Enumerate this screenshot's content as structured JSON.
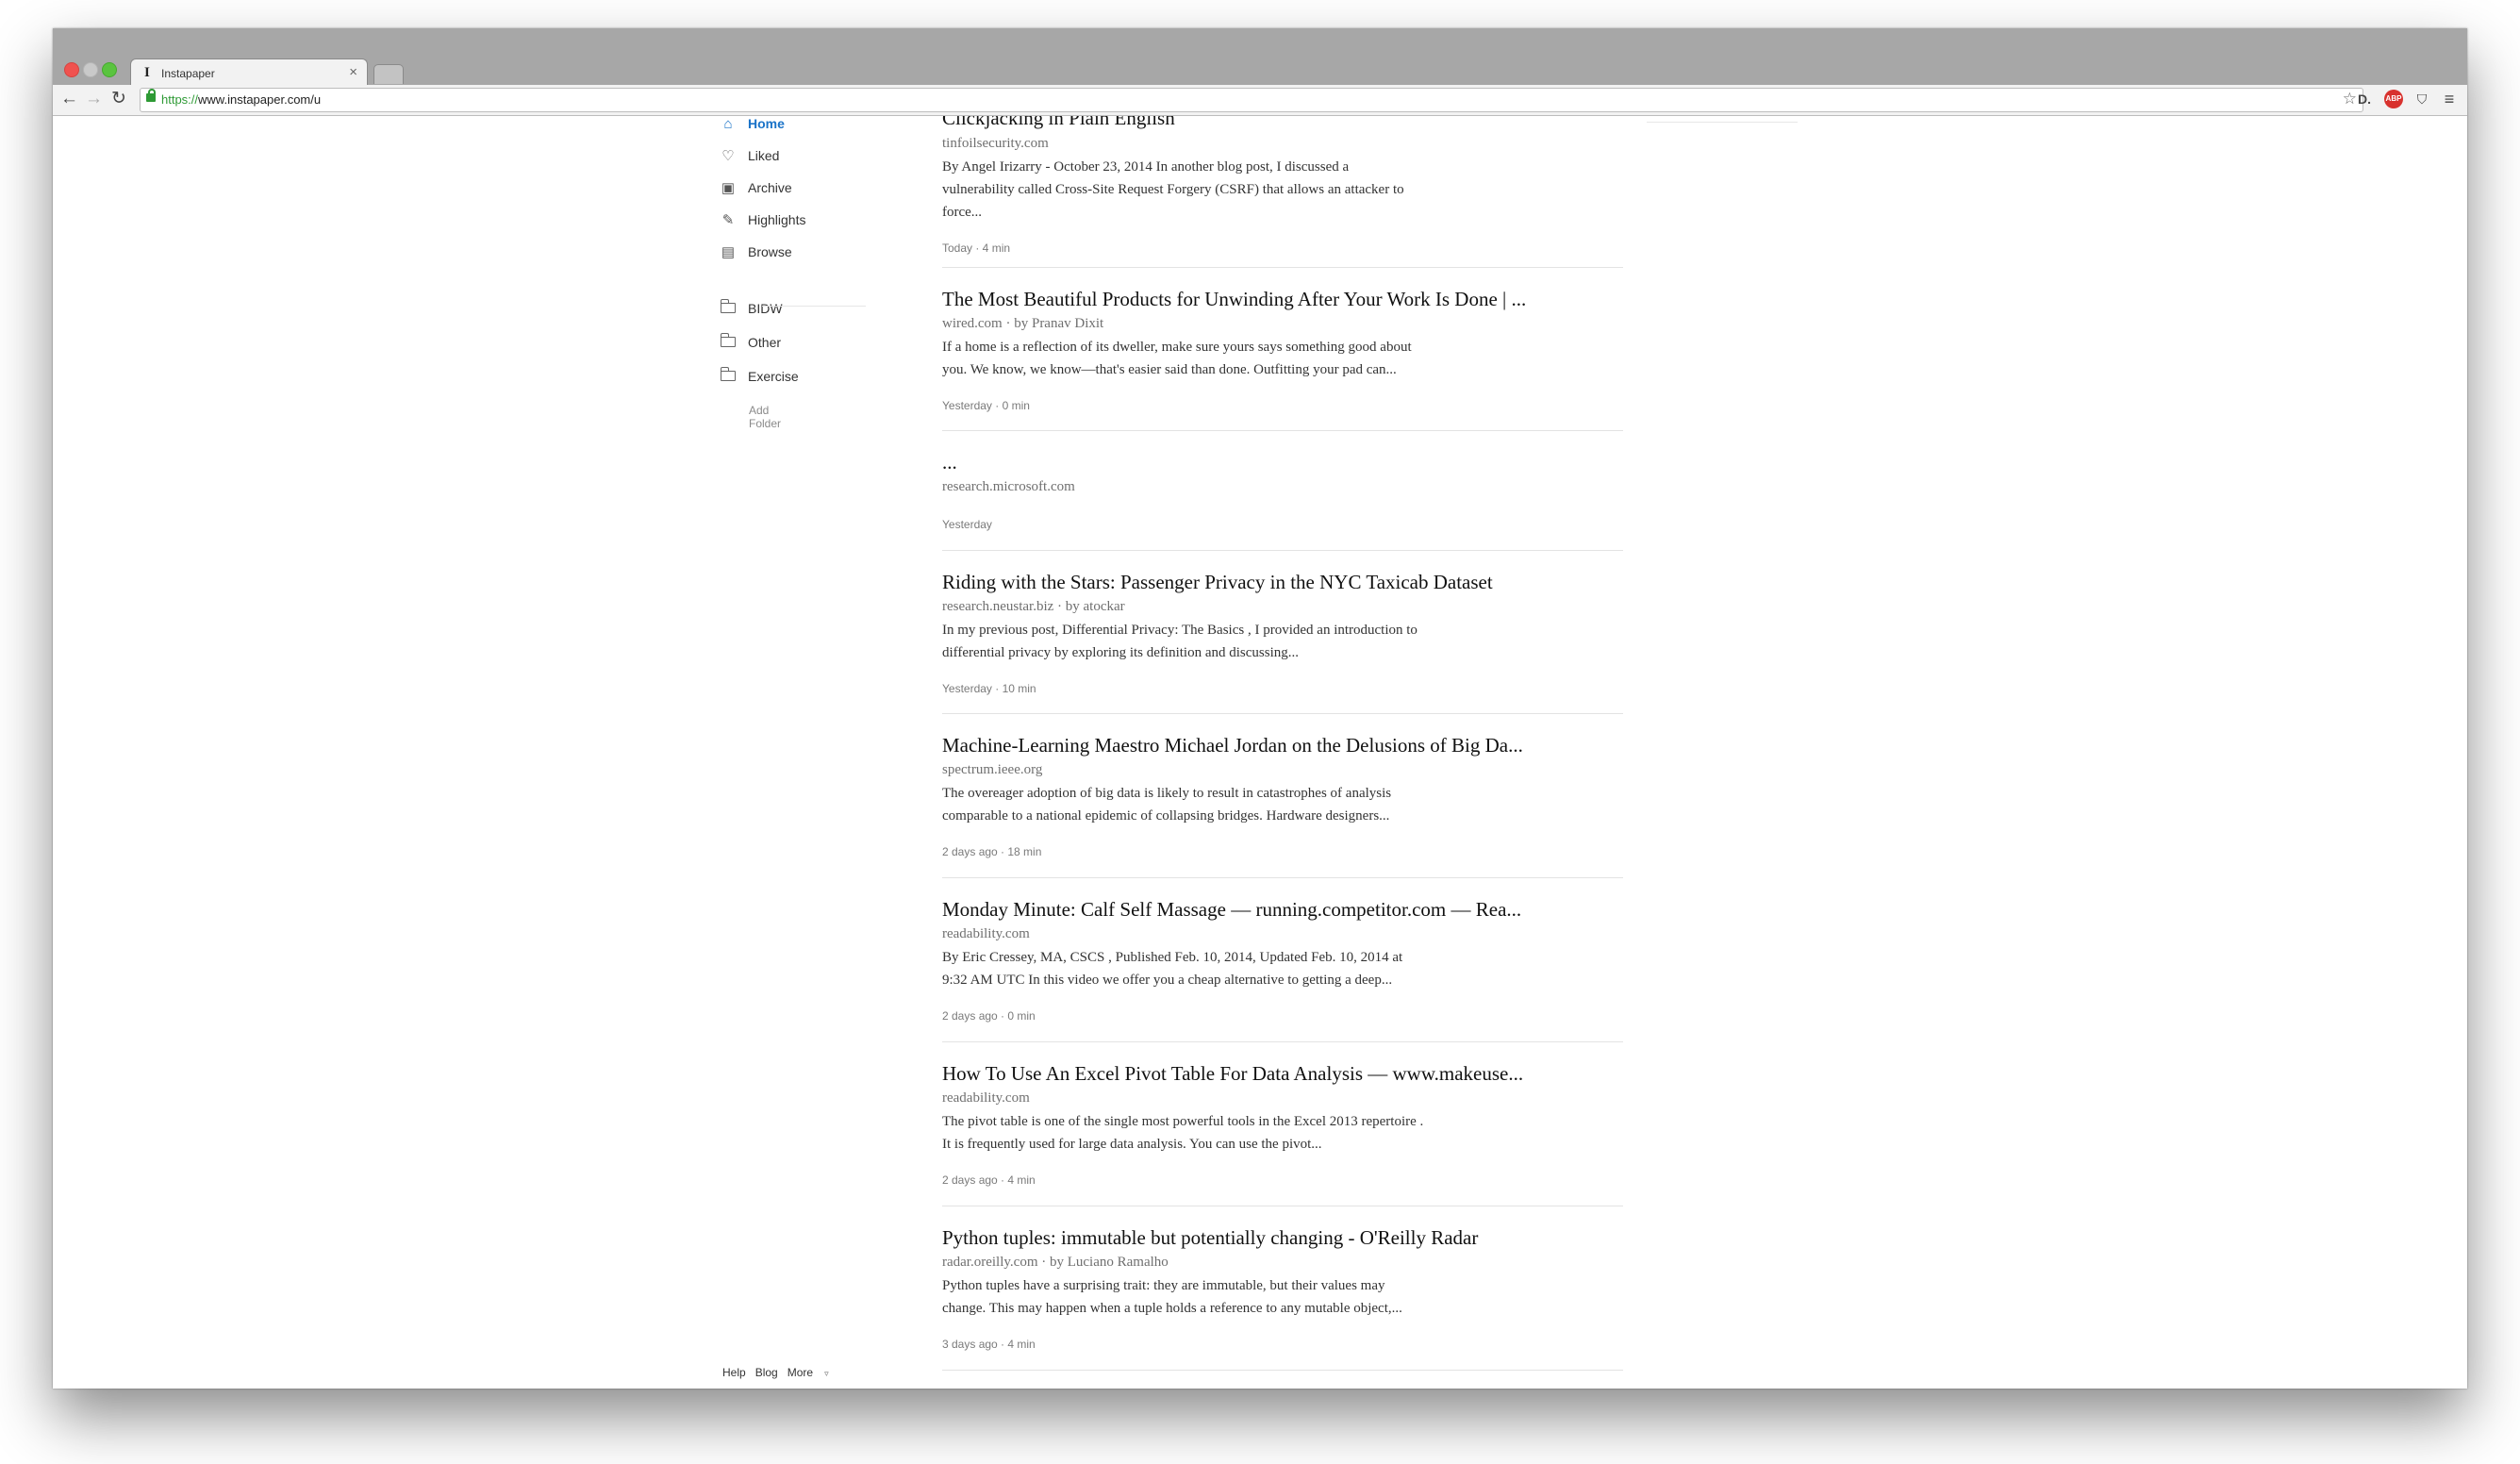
{
  "browser": {
    "tab_title": "Instapaper",
    "tab_favicon": "I",
    "url_scheme": "https://",
    "url_rest": "www.instapaper.com/u",
    "adblock_label": "ABP"
  },
  "sidebar": {
    "nav": [
      {
        "label": "Home",
        "icon": "home-icon",
        "active": true
      },
      {
        "label": "Liked",
        "icon": "heart-icon"
      },
      {
        "label": "Archive",
        "icon": "archive-icon"
      },
      {
        "label": "Highlights",
        "icon": "pencil-icon"
      },
      {
        "label": "Browse",
        "icon": "browse-icon"
      }
    ],
    "folders": [
      {
        "label": "BIDW",
        "icon": "folder-icon"
      },
      {
        "label": "Other",
        "icon": "folder-icon"
      },
      {
        "label": "Exercise",
        "icon": "folder-icon"
      }
    ],
    "add_folder": "Add Folder",
    "footer": {
      "help": "Help",
      "blog": "Blog",
      "more": "More"
    }
  },
  "articles": [
    {
      "title": "Clickjacking in Plain English",
      "meta": "tinfoilsecurity.com",
      "excerpt": [
        "By Angel Irizarry - October 23, 2014 In another blog post, I discussed a",
        "vulnerability called Cross-Site Request Forgery (CSRF) that allows an attacker to",
        "force..."
      ],
      "foot": "Today · 4 min"
    },
    {
      "title": "The Most Beautiful Products for Unwinding After Your Work Is Done | ...",
      "meta": "wired.com · by Pranav Dixit",
      "excerpt": [
        "If a home is a reflection of its dweller, make sure yours says something good about",
        "you. We know, we know—that's easier said than done. Outfitting your pad can..."
      ],
      "foot": "Yesterday · 0 min"
    },
    {
      "title": "...",
      "meta": "research.microsoft.com",
      "excerpt": [],
      "foot": "Yesterday"
    },
    {
      "title": "Riding with the Stars: Passenger Privacy in the NYC Taxicab Dataset",
      "meta": "research.neustar.biz · by atockar",
      "excerpt": [
        "In my previous post,  Differential Privacy: The Basics , I provided an introduction to",
        "differential privacy by exploring its definition and discussing..."
      ],
      "foot": "Yesterday · 10 min"
    },
    {
      "title": "Machine-Learning Maestro Michael Jordan on the Delusions of Big Da...",
      "meta": "spectrum.ieee.org",
      "excerpt": [
        "The overeager adoption of big data is likely to result in catastrophes of analysis",
        "comparable to a national epidemic of collapsing bridges. Hardware designers..."
      ],
      "foot": "2 days ago · 18 min"
    },
    {
      "title": "Monday Minute: Calf Self Massage — running.competitor.com — Rea...",
      "meta": "readability.com",
      "excerpt": [
        "By Eric Cressey, MA, CSCS , Published Feb. 10, 2014, Updated Feb. 10, 2014 at",
        "9:32 AM UTC In this video we offer you a cheap alternative to getting a deep..."
      ],
      "foot": "2 days ago · 0 min"
    },
    {
      "title": "How To Use An Excel Pivot Table For Data Analysis — www.makeuse...",
      "meta": "readability.com",
      "excerpt": [
        "The pivot table is one of the single most powerful tools in the Excel 2013 repertoire .",
        "It is frequently used for large data analysis. You can use the pivot..."
      ],
      "foot": "2 days ago · 4 min"
    },
    {
      "title": "Python tuples: immutable but potentially changing - O'Reilly Radar",
      "meta": "radar.oreilly.com · by Luciano Ramalho",
      "excerpt": [
        "Python tuples have a surprising trait: they are immutable, but their values may",
        "change. This may happen when a tuple holds a reference to any mutable object,..."
      ],
      "foot": "3 days ago · 4 min"
    }
  ]
}
